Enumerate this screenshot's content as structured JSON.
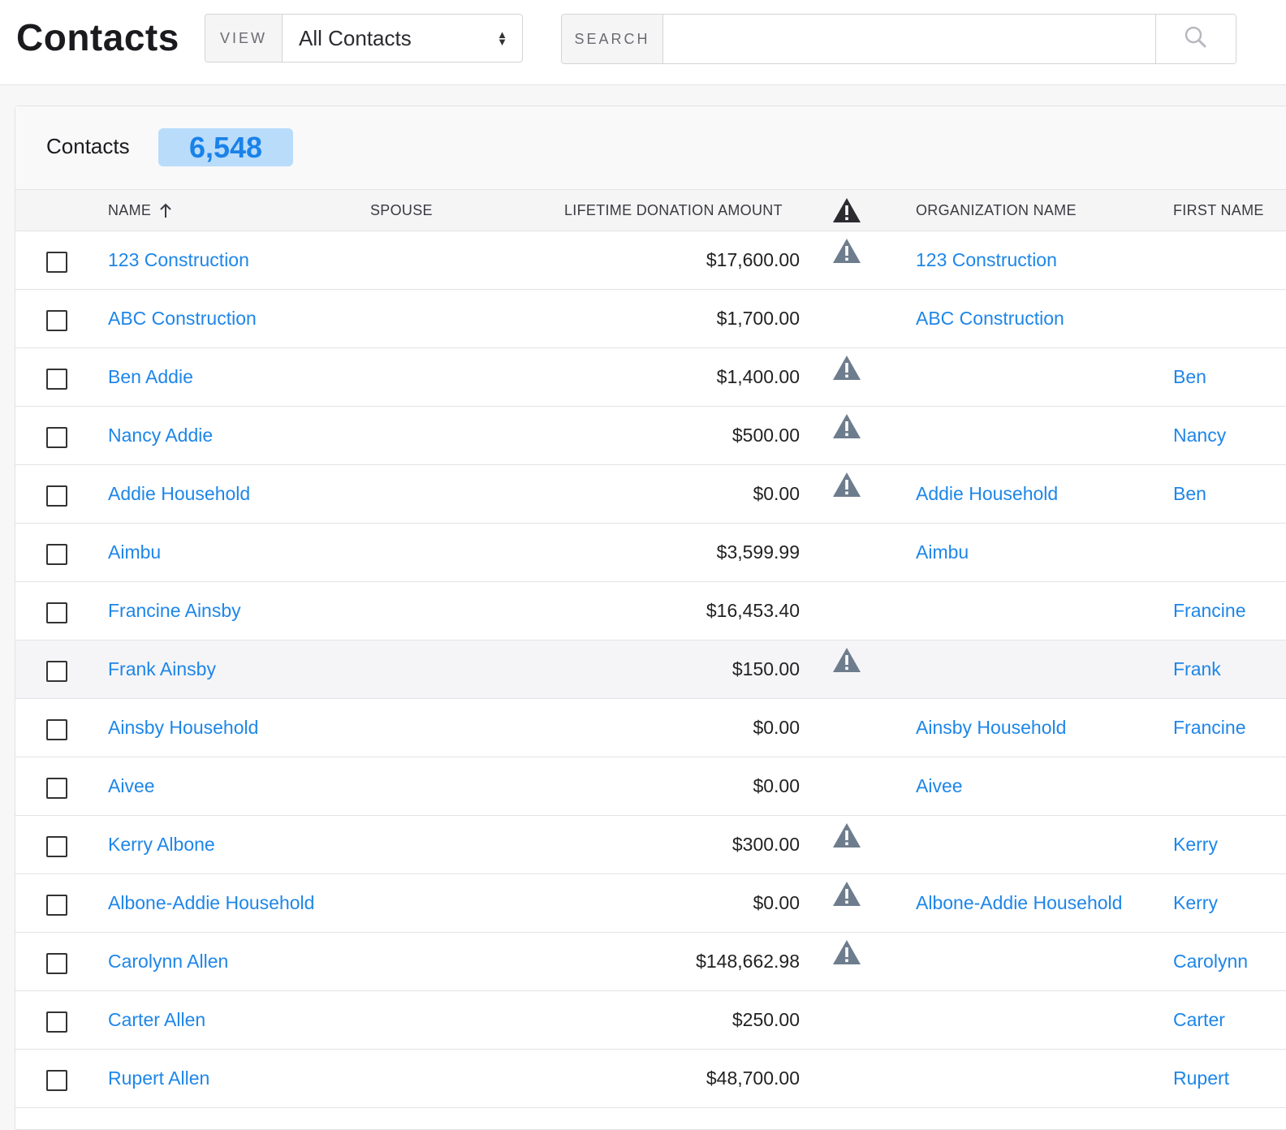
{
  "header": {
    "title": "Contacts",
    "view_label": "VIEW",
    "view_value": "All Contacts",
    "search_label": "SEARCH",
    "search_value": "",
    "search_placeholder": ""
  },
  "panel": {
    "title": "Contacts",
    "count": "6,548"
  },
  "table": {
    "columns": {
      "name": "NAME",
      "spouse": "SPOUSE",
      "lifetime": "LIFETIME DONATION AMOUNT",
      "organization": "ORGANIZATION NAME",
      "first_name": "FIRST NAME"
    },
    "sort_column": "name",
    "sort_direction": "ascending",
    "highlighted_row": 7,
    "rows": [
      {
        "name": "123 Construction",
        "spouse": "",
        "amount": "$17,600.00",
        "warning": true,
        "organization": "123 Construction",
        "first_name": ""
      },
      {
        "name": "ABC Construction",
        "spouse": "",
        "amount": "$1,700.00",
        "warning": false,
        "organization": "ABC Construction",
        "first_name": ""
      },
      {
        "name": "Ben Addie",
        "spouse": "",
        "amount": "$1,400.00",
        "warning": true,
        "organization": "",
        "first_name": "Ben"
      },
      {
        "name": "Nancy Addie",
        "spouse": "",
        "amount": "$500.00",
        "warning": true,
        "organization": "",
        "first_name": "Nancy"
      },
      {
        "name": "Addie Household",
        "spouse": "",
        "amount": "$0.00",
        "warning": true,
        "organization": "Addie Household",
        "first_name": "Ben"
      },
      {
        "name": "Aimbu",
        "spouse": "",
        "amount": "$3,599.99",
        "warning": false,
        "organization": "Aimbu",
        "first_name": ""
      },
      {
        "name": "Francine Ainsby",
        "spouse": "",
        "amount": "$16,453.40",
        "warning": false,
        "organization": "",
        "first_name": "Francine"
      },
      {
        "name": "Frank Ainsby",
        "spouse": "",
        "amount": "$150.00",
        "warning": true,
        "organization": "",
        "first_name": "Frank"
      },
      {
        "name": "Ainsby Household",
        "spouse": "",
        "amount": "$0.00",
        "warning": false,
        "organization": "Ainsby Household",
        "first_name": "Francine"
      },
      {
        "name": "Aivee",
        "spouse": "",
        "amount": "$0.00",
        "warning": false,
        "organization": "Aivee",
        "first_name": ""
      },
      {
        "name": "Kerry Albone",
        "spouse": "",
        "amount": "$300.00",
        "warning": true,
        "organization": "",
        "first_name": "Kerry"
      },
      {
        "name": "Albone-Addie Household",
        "spouse": "",
        "amount": "$0.00",
        "warning": true,
        "organization": "Albone-Addie Household",
        "first_name": "Kerry"
      },
      {
        "name": "Carolynn Allen",
        "spouse": "",
        "amount": "$148,662.98",
        "warning": true,
        "organization": "",
        "first_name": "Carolynn"
      },
      {
        "name": "Carter Allen",
        "spouse": "",
        "amount": "$250.00",
        "warning": false,
        "organization": "",
        "first_name": "Carter"
      },
      {
        "name": "Rupert Allen",
        "spouse": "",
        "amount": "$48,700.00",
        "warning": false,
        "organization": "",
        "first_name": "Rupert"
      }
    ]
  },
  "icons": {
    "sort": "arrow-up-icon",
    "search": "search-icon",
    "warning": "warning-triangle-icon",
    "select_caret": "sort-caret-icon"
  },
  "colors": {
    "link": "#1e86e8",
    "badge_bg": "#b9dcfb",
    "badge_text": "#1a82e8",
    "warning_header": "#2b2b30",
    "warning_row": "#6e7d8d"
  }
}
